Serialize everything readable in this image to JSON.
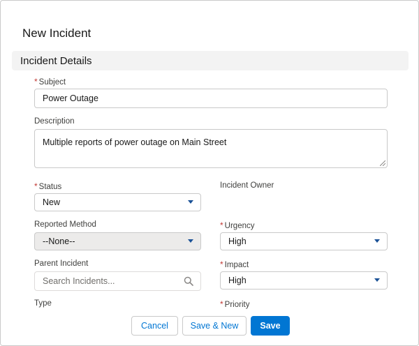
{
  "modal": {
    "title": "New Incident",
    "section_title": "Incident Details"
  },
  "fields": {
    "subject": {
      "label": "Subject",
      "value": "Power Outage",
      "required": true
    },
    "description": {
      "label": "Description",
      "value": "Multiple reports of power outage on Main Street"
    },
    "status": {
      "label": "Status",
      "value": "New",
      "required": true
    },
    "incident_owner": {
      "label": "Incident Owner"
    },
    "reported_method": {
      "label": "Reported Method",
      "value": "--None--"
    },
    "urgency": {
      "label": "Urgency",
      "value": "High",
      "required": true
    },
    "parent_incident": {
      "label": "Parent Incident",
      "placeholder": "Search Incidents..."
    },
    "impact": {
      "label": "Impact",
      "value": "High",
      "required": true
    },
    "type": {
      "label": "Type"
    },
    "priority": {
      "label": "Priority",
      "required": true
    }
  },
  "required_marker": "*",
  "footer": {
    "cancel_label": "Cancel",
    "save_new_label": "Save & New",
    "save_label": "Save"
  },
  "icons": {
    "search": "search-icon",
    "dropdown": "chevron-down-icon",
    "resize": "resize-handle-icon"
  },
  "colors": {
    "brand": "#0176d3",
    "required": "#c23934",
    "section_bg": "#f3f3f3"
  }
}
